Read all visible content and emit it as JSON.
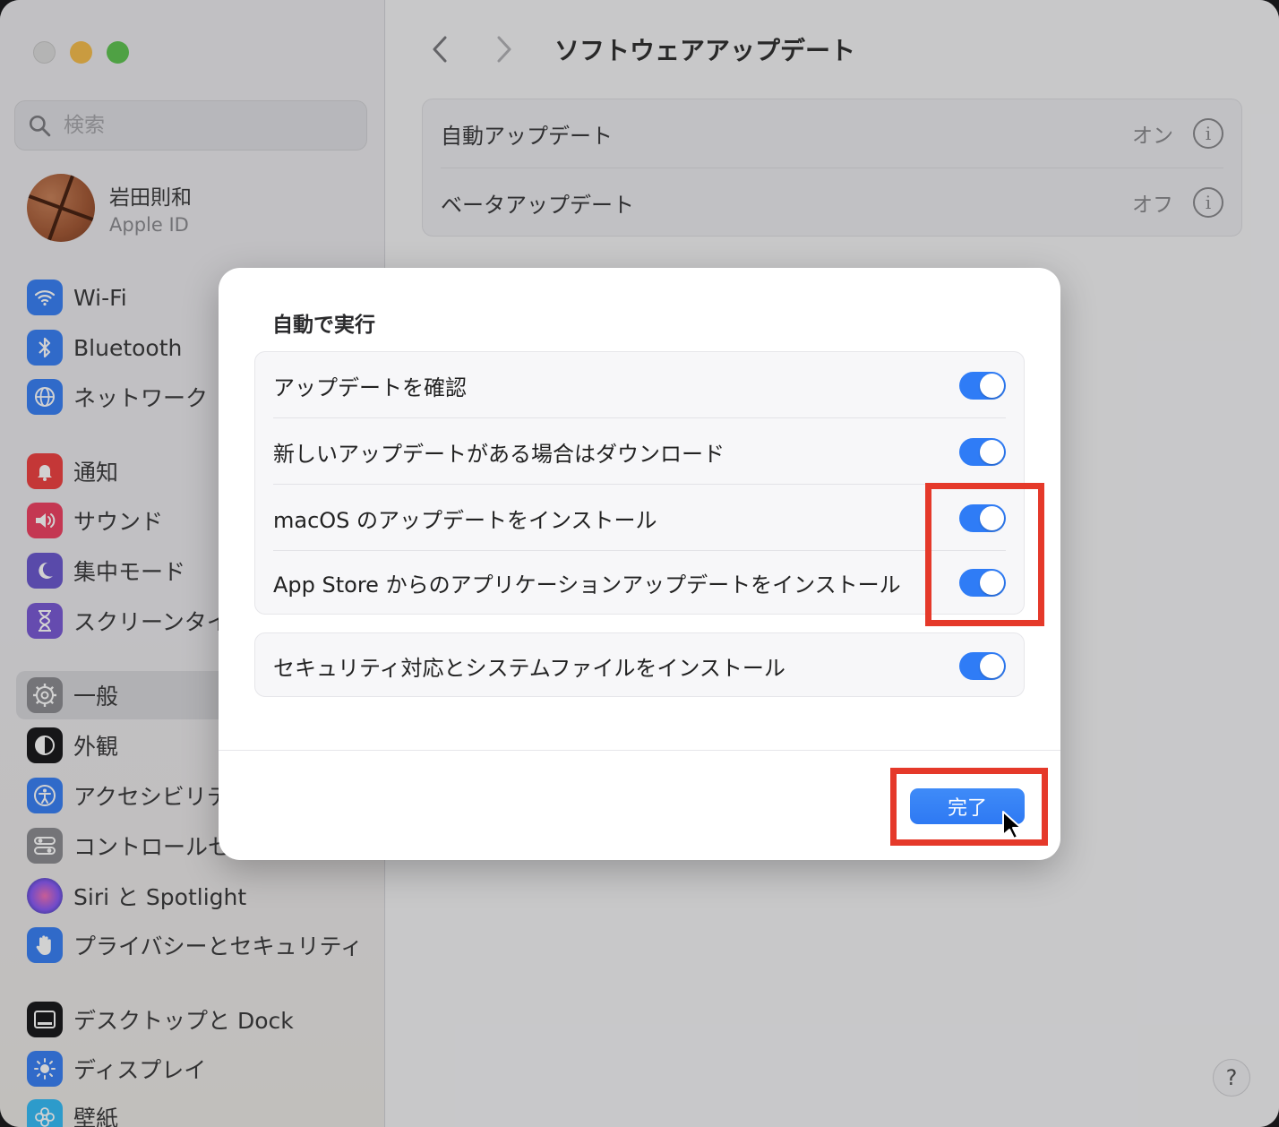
{
  "window": {
    "title": "ソフトウェアアップデート"
  },
  "sidebar": {
    "search_placeholder": "検索",
    "profile": {
      "name": "岩田則和",
      "subtitle": "Apple ID"
    },
    "items": [
      {
        "label": "Wi-Fi",
        "icon": "wifi-icon",
        "color": "#3b82f6"
      },
      {
        "label": "Bluetooth",
        "icon": "bluetooth-icon",
        "color": "#3b82f6"
      },
      {
        "label": "ネットワーク",
        "icon": "globe-icon",
        "color": "#3b82f6"
      },
      {
        "label": "通知",
        "icon": "bell-icon",
        "color": "#ef4444"
      },
      {
        "label": "サウンド",
        "icon": "speaker-icon",
        "color": "#ef4464"
      },
      {
        "label": "集中モード",
        "icon": "moon-icon",
        "color": "#6d5bd0"
      },
      {
        "label": "スクリーンタイム",
        "icon": "hourglass-icon",
        "color": "#7c5cd6"
      },
      {
        "label": "一般",
        "icon": "gear-icon",
        "color": "#8e8e93",
        "selected": true
      },
      {
        "label": "外観",
        "icon": "appearance-icon",
        "color": "#1c1c1e"
      },
      {
        "label": "アクセシビリティ",
        "icon": "accessibility-icon",
        "color": "#3b82f6"
      },
      {
        "label": "コントロールセンター",
        "icon": "switches-icon",
        "color": "#8e8e93"
      },
      {
        "label": "Siri と Spotlight",
        "icon": "siri-icon",
        "color": "#8b5cf6"
      },
      {
        "label": "プライバシーとセキュリティ",
        "icon": "hand-icon",
        "color": "#3b82f6"
      },
      {
        "label": "デスクトップと Dock",
        "icon": "dock-icon",
        "color": "#1c1c1e"
      },
      {
        "label": "ディスプレイ",
        "icon": "sun-icon",
        "color": "#3b82f6"
      },
      {
        "label": "壁紙",
        "icon": "flower-icon",
        "color": "#38bdf8"
      }
    ]
  },
  "main": {
    "rows": [
      {
        "label": "自動アップデート",
        "value": "オン"
      },
      {
        "label": "ベータアップデート",
        "value": "オフ"
      }
    ],
    "help": "?"
  },
  "dialog": {
    "title": "自動で実行",
    "group1": [
      {
        "label": "アップデートを確認",
        "on": true
      },
      {
        "label": "新しいアップデートがある場合はダウンロード",
        "on": true
      },
      {
        "label": "macOS のアップデートをインストール",
        "on": true
      },
      {
        "label": "App Store からのアプリケーションアップデートをインストール",
        "on": true
      }
    ],
    "group2": [
      {
        "label": "セキュリティ対応とシステムファイルをインストール",
        "on": true
      }
    ],
    "done_label": "完了"
  }
}
